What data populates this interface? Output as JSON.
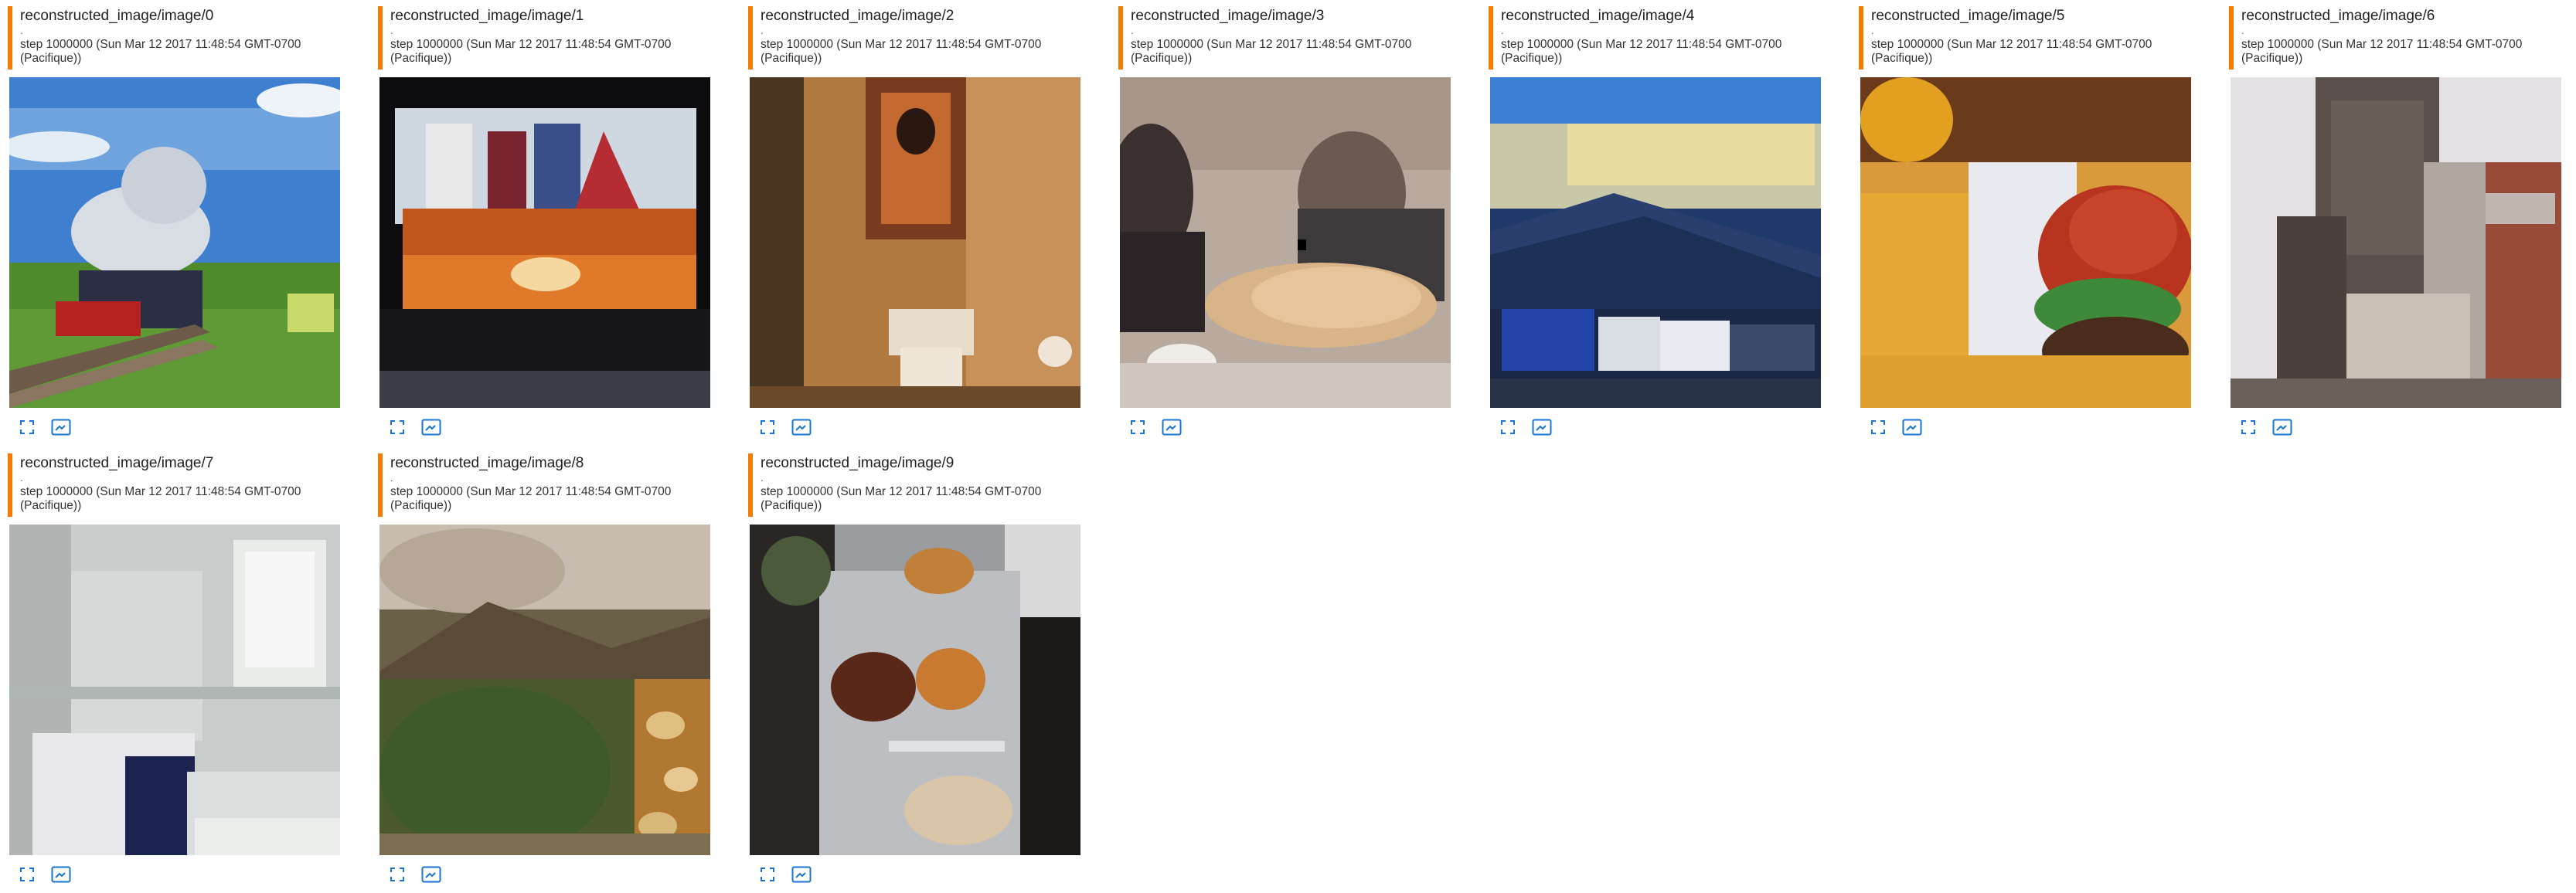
{
  "colors": {
    "accent_bar": "#f57c00",
    "control_icon": "#1976d2"
  },
  "cards": [
    {
      "title": "reconstructed_image/image/0",
      "dot": ".",
      "step": "step 1000000 (Sun Mar 12 2017 11:48:54 GMT-0700 (Pacifique))",
      "scene": "train"
    },
    {
      "title": "reconstructed_image/image/1",
      "dot": ".",
      "step": "step 1000000 (Sun Mar 12 2017 11:48:54 GMT-0700 (Pacifique))",
      "scene": "couch"
    },
    {
      "title": "reconstructed_image/image/2",
      "dot": ".",
      "step": "step 1000000 (Sun Mar 12 2017 11:48:54 GMT-0700 (Pacifique))",
      "scene": "bathroom-toilet"
    },
    {
      "title": "reconstructed_image/image/3",
      "dot": ".",
      "step": "step 1000000 (Sun Mar 12 2017 11:48:54 GMT-0700 (Pacifique))",
      "scene": "people-pizza"
    },
    {
      "title": "reconstructed_image/image/4",
      "dot": ".",
      "step": "step 1000000 (Sun Mar 12 2017 11:48:54 GMT-0700 (Pacifique))",
      "scene": "trucks-mountains"
    },
    {
      "title": "reconstructed_image/image/5",
      "dot": ".",
      "step": "step 1000000 (Sun Mar 12 2017 11:48:54 GMT-0700 (Pacifique))",
      "scene": "burger-fries"
    },
    {
      "title": "reconstructed_image/image/6",
      "dot": ".",
      "step": "step 1000000 (Sun Mar 12 2017 11:48:54 GMT-0700 (Pacifique))",
      "scene": "clock-tower"
    },
    {
      "title": "reconstructed_image/image/7",
      "dot": ".",
      "step": "step 1000000 (Sun Mar 12 2017 11:48:54 GMT-0700 (Pacifique))",
      "scene": "bathroom-tub"
    },
    {
      "title": "reconstructed_image/image/8",
      "dot": ".",
      "step": "step 1000000 (Sun Mar 12 2017 11:48:54 GMT-0700 (Pacifique))",
      "scene": "giraffe-tree"
    },
    {
      "title": "reconstructed_image/image/9",
      "dot": ".",
      "step": "step 1000000 (Sun Mar 12 2017 11:48:54 GMT-0700 (Pacifique))",
      "scene": "food-tray"
    }
  ],
  "controls": {
    "fullscreen_icon": "fullscreen-icon",
    "actual_size_icon": "actual-size-icon"
  }
}
